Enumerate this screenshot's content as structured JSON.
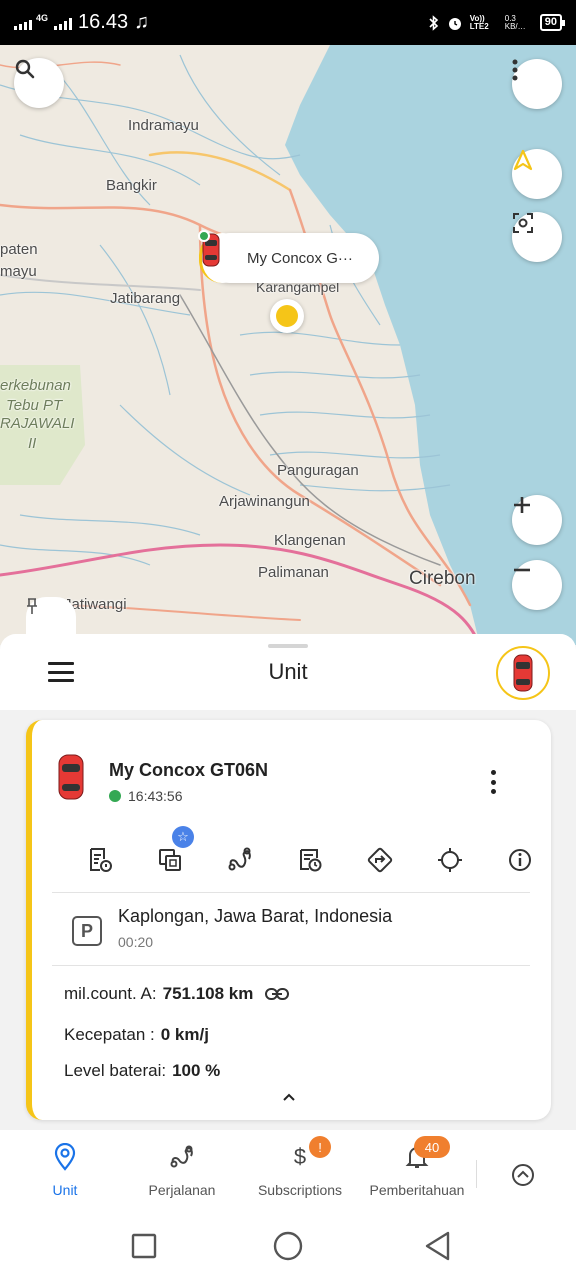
{
  "status_bar": {
    "network": "4G",
    "time": "16.43",
    "volte": "Vo)) LTE2",
    "speed": "0.3 KB/…",
    "battery": "90"
  },
  "map": {
    "labels": [
      "Indramayu",
      "Bangkir",
      "paten",
      "mayu",
      "Jatibarang",
      "Karangampel",
      "erkebunan",
      "Tebu PT",
      "RAJAWALI",
      "II",
      "Panguragan",
      "Arjawinangun",
      "Klangenan",
      "Palimanan",
      "Cirebon",
      "Jatiwangi"
    ],
    "unit_bubble_label": "My Concox G···",
    "controls": [
      "search-icon",
      "more-vert-icon",
      "navigation-arrow-icon",
      "focus-icon",
      "zoom-in-icon",
      "zoom-out-icon",
      "pin-icon"
    ]
  },
  "sheet": {
    "title": "Unit"
  },
  "unit_card": {
    "name": "My Concox GT06N",
    "time": "16:43:56",
    "status_color": "#34a853",
    "accent_color": "#f5c518",
    "actions": [
      "report-icon",
      "copy-icon",
      "trips-icon",
      "history-icon",
      "directions-icon",
      "locate-icon",
      "info-icon"
    ],
    "address": "Kaplongan, Jawa Barat, Indonesia",
    "parked_duration": "00:20",
    "mileage_label": "mil.count. A:",
    "mileage_value": "751.108 km",
    "speed_label": "Kecepatan :",
    "speed_value": "0 km/j",
    "battery_label": "Level baterai:",
    "battery_value": "100 %"
  },
  "bottom_nav": {
    "items": [
      {
        "label": "Unit",
        "icon": "location-pin-icon",
        "active": true
      },
      {
        "label": "Perjalanan",
        "icon": "trips-icon"
      },
      {
        "label": "Subscriptions",
        "icon": "dollar-icon",
        "badge": "!"
      },
      {
        "label": "Pemberitahuan",
        "icon": "bell-icon",
        "badge": "40"
      }
    ],
    "accent_color": "#1a73e8",
    "badge_color": "#f07f2e"
  }
}
